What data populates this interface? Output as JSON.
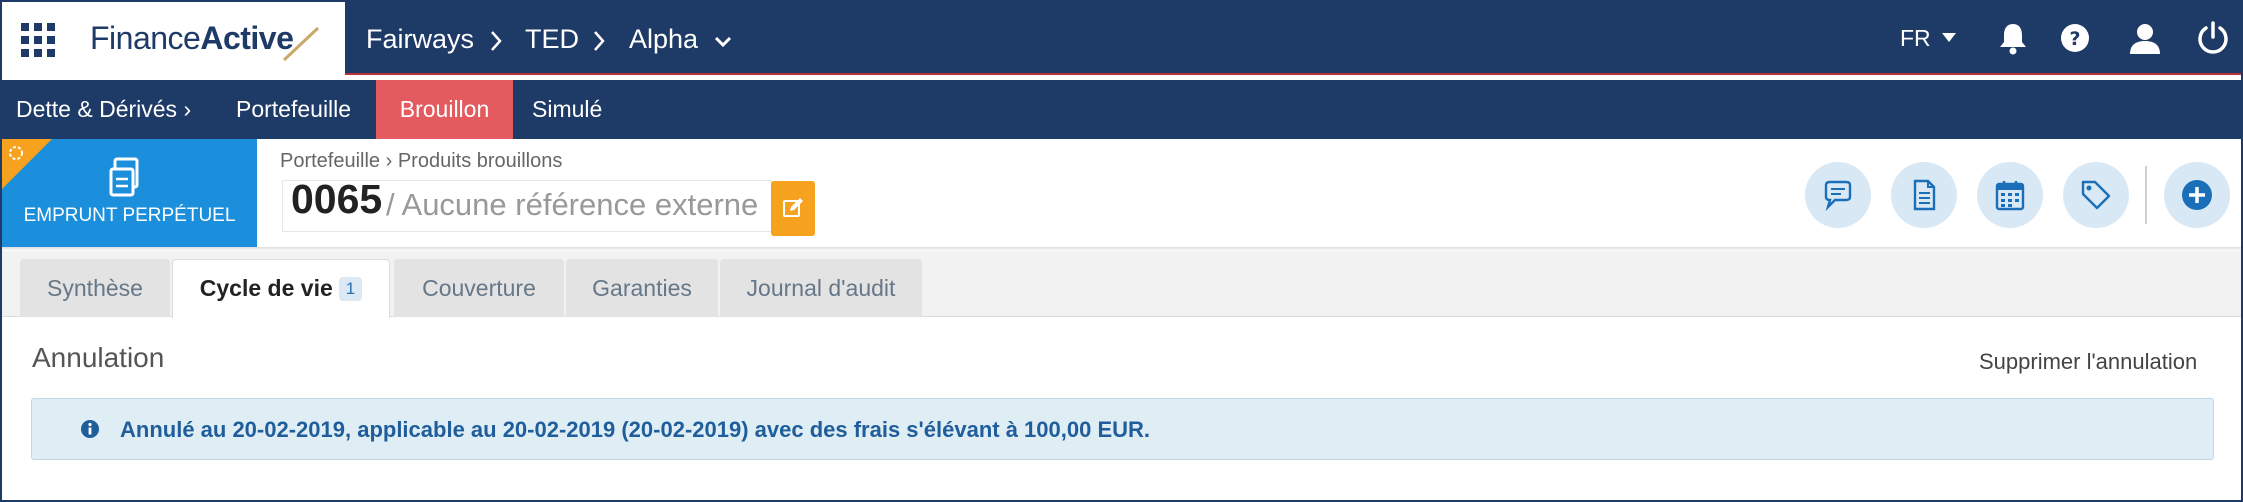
{
  "brand": {
    "name_regular": "Finance",
    "name_bold": "Active"
  },
  "breadcrumb": [
    {
      "label": "Fairways"
    },
    {
      "label": "TED"
    },
    {
      "label": "Alpha"
    }
  ],
  "topbar": {
    "language": "FR",
    "icons": [
      "apps-grid-icon",
      "bell-icon",
      "help-icon",
      "user-icon",
      "power-icon"
    ]
  },
  "subnav": {
    "items": [
      {
        "label": "Dette & Dérivés ›"
      },
      {
        "label": "Portefeuille"
      },
      {
        "label": "Brouillon",
        "active": true
      },
      {
        "label": "Simulé"
      }
    ]
  },
  "product": {
    "type_label": "EMPRUNT PERPÉTUEL",
    "breadcrumb": "Portefeuille › Produits brouillons",
    "number": "0065",
    "external_ref": "/ Aucune référence externe"
  },
  "header_actions": [
    "comment-icon",
    "document-icon",
    "calendar-icon",
    "tag-icon",
    "add-icon"
  ],
  "tabs": [
    {
      "label": "Synthèse"
    },
    {
      "label": "Cycle de vie",
      "count": "1",
      "active": true
    },
    {
      "label": "Couverture"
    },
    {
      "label": "Garanties"
    },
    {
      "label": "Journal d'audit"
    }
  ],
  "section": {
    "title": "Annulation",
    "action_label": "Supprimer l'annulation",
    "alert_text": "Annulé au 20-02-2019, applicable au 20-02-2019 (20-02-2019) avec des frais s'élévant à 100,00 EUR."
  },
  "colors": {
    "navy": "#1e3a66",
    "active_tab_red": "#e35a5f",
    "badge_blue": "#1b8fdb",
    "edit_orange": "#f6a21e",
    "alert_bg": "#dfedf5",
    "alert_text": "#1f5e9b"
  }
}
